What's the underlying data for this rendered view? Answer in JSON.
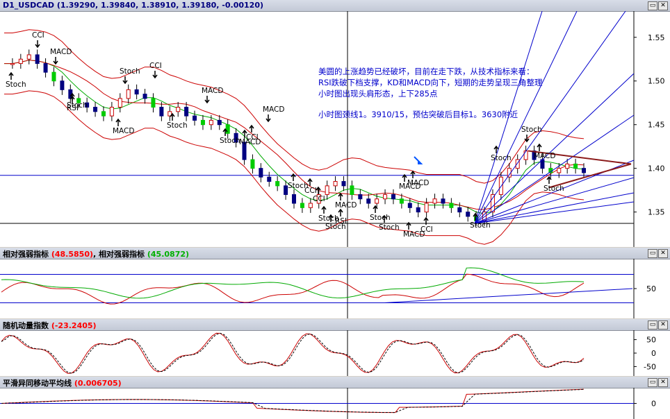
{
  "panels": {
    "main": {
      "symbol": "D1_USDCAD",
      "values": "(1.39290, 1.39840, 1.38910, 1.39180, -0.00120)"
    },
    "rsi": {
      "name": "相对强弱指标",
      "value1": "(48.5850)",
      "name2": "相对强弱指标",
      "value2": "(45.0872)"
    },
    "momentum": {
      "name": "随机动量指数",
      "value": "(-23.2405)"
    },
    "macd": {
      "name": "平滑异同移动平均线",
      "value": "(0.006705)"
    }
  },
  "window_buttons": {
    "minimize": "▭",
    "close": "✕"
  },
  "annotation": {
    "line1": "美圆的上涨趋势已经破坏，目前在走下跌，从技术指标来看：",
    "line2": "RSI跌破下档支撑，KD和MACD向下，短期的走势呈现三角整理",
    "line3": "小时图出现头肩形态，上下285点",
    "line4": "小时图颈线1。3910/15，预估突破后目标1。3630附近"
  },
  "chart_data": {
    "type": "candlestick",
    "symbol": "USDCAD",
    "timeframe": "D1",
    "ylim": [
      1.31,
      1.58
    ],
    "yticks": [
      1.35,
      1.4,
      1.45,
      1.5,
      1.55
    ],
    "ytick_labels": [
      "1.35",
      "1.40",
      "1.45",
      "1.50",
      "1.55"
    ],
    "close_path": [
      1.52,
      1.52,
      1.525,
      1.53,
      1.52,
      1.51,
      1.5,
      1.49,
      1.48,
      1.475,
      1.47,
      1.465,
      1.46,
      1.47,
      1.48,
      1.49,
      1.485,
      1.48,
      1.47,
      1.46,
      1.465,
      1.47,
      1.46,
      1.455,
      1.45,
      1.455,
      1.45,
      1.44,
      1.43,
      1.41,
      1.4,
      1.39,
      1.385,
      1.38,
      1.37,
      1.36,
      1.355,
      1.36,
      1.37,
      1.38,
      1.385,
      1.38,
      1.37,
      1.365,
      1.36,
      1.365,
      1.37,
      1.365,
      1.36,
      1.355,
      1.35,
      1.36,
      1.365,
      1.36,
      1.355,
      1.35,
      1.345,
      1.34,
      1.35,
      1.37,
      1.39,
      1.4,
      1.41,
      1.42,
      1.41,
      1.4,
      1.395,
      1.4,
      1.405,
      1.4,
      1.395
    ],
    "annotations_on_chart": [
      "CCI",
      "MACD",
      "Stoch",
      "RSI"
    ],
    "horizontal_lines": [
      1.392,
      1.337
    ],
    "rsi": {
      "ref_levels": [
        70,
        30
      ],
      "ytick_labels": [
        "50"
      ],
      "series": [
        {
          "name": "相对强弱指标",
          "last": 48.585
        },
        {
          "name": "相对强弱指标",
          "last": 45.0872
        }
      ]
    },
    "momentum": {
      "ytick_labels": [
        "50",
        "0",
        "-50"
      ],
      "last": -23.2405
    },
    "macd": {
      "ytick_labels": [
        "0"
      ],
      "last": 0.006705
    }
  }
}
